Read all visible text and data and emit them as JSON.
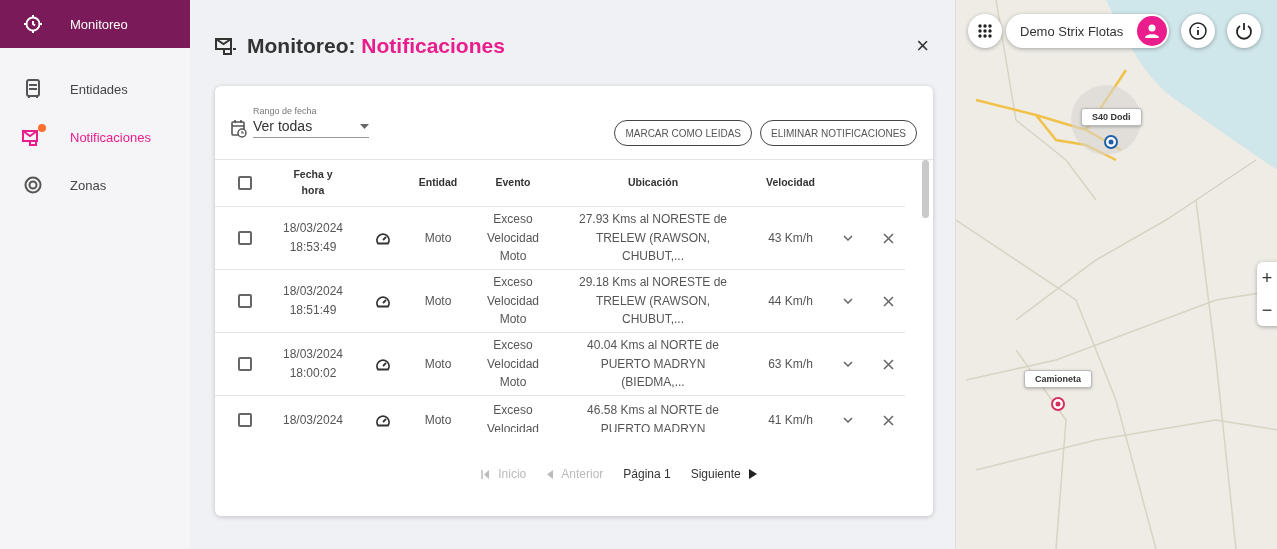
{
  "sidebar": {
    "items": [
      {
        "label": "Monitoreo",
        "kind": "monitor",
        "selected": true,
        "current": false,
        "has_alert": false
      },
      {
        "label": "Entidades",
        "kind": "entities",
        "selected": false,
        "current": false,
        "has_alert": false
      },
      {
        "label": "Notificaciones",
        "kind": "notifications",
        "selected": false,
        "current": true,
        "has_alert": true
      },
      {
        "label": "Zonas",
        "kind": "zones",
        "selected": false,
        "current": false,
        "has_alert": false
      }
    ]
  },
  "panel": {
    "title_prefix": "Monitoreo:",
    "title": "Notificaciones",
    "close": "×"
  },
  "filter": {
    "label": "Rango de fecha",
    "value": "Ver todas"
  },
  "buttons": [
    "MARCAR COMO LEIDAS",
    "ELIMINAR NOTIFICACIONES"
  ],
  "table": {
    "select_all_checked": false,
    "columns": [
      "Fecha y hora",
      "Entidad",
      "Evento",
      "Ubicación",
      "Velocidad"
    ],
    "rows": [
      {
        "checked": false,
        "date": "18/03/2024",
        "time": "18:53:49",
        "entity": "Moto",
        "event": "Exceso Velocidad Moto",
        "location": "27.93 Kms al NORESTE de TRELEW (RAWSON, CHUBUT,...",
        "speed": "43 Km/h"
      },
      {
        "checked": false,
        "date": "18/03/2024",
        "time": "18:51:49",
        "entity": "Moto",
        "event": "Exceso Velocidad Moto",
        "location": "29.18 Kms al NORESTE de TRELEW (RAWSON, CHUBUT,...",
        "speed": "44 Km/h"
      },
      {
        "checked": false,
        "date": "18/03/2024",
        "time": "18:00:02",
        "entity": "Moto",
        "event": "Exceso Velocidad Moto",
        "location": "40.04 Kms al NORTE de PUERTO MADRYN (BIEDMA,...",
        "speed": "63 Km/h"
      },
      {
        "checked": false,
        "date": "18/03/2024",
        "entity": "Moto",
        "event": "Exceso Velocidad",
        "location": "46.58 Kms al NORTE de PUERTO MADRYN",
        "speed": "41 Km/h"
      }
    ]
  },
  "pagination": [
    {
      "label": "Inicio",
      "kind": "first",
      "disabled": true
    },
    {
      "label": "Anterior",
      "kind": "prev",
      "disabled": true
    },
    {
      "label": "Página 1",
      "kind": "page",
      "disabled": false
    },
    {
      "label": "Siguiente",
      "kind": "next",
      "disabled": false
    }
  ],
  "map": {
    "account": "Demo Strix Flotas",
    "markers": [
      {
        "label": "S40 Dodi",
        "color": "#1e5fa8"
      },
      {
        "label": "Camioneta",
        "color": "#d32f5f"
      }
    ],
    "zoom_in": "+",
    "zoom_out": "−"
  }
}
